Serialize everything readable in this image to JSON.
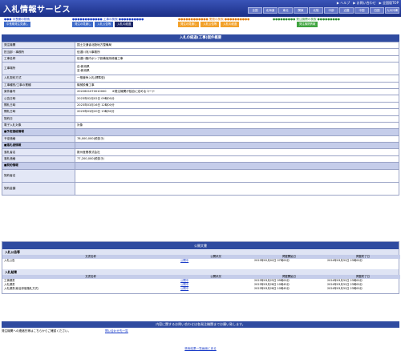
{
  "header": {
    "title": "入札情報サービス",
    "links": [
      "▶ ヘルプ",
      "▶ お問い合わせ",
      "▶ 全国版TOP"
    ],
    "regions": [
      "全国",
      "北海道",
      "東北",
      "関東",
      "北陸",
      "中部",
      "近畿",
      "中国",
      "四国",
      "九州沖縄"
    ]
  },
  "nav": {
    "groups": [
      {
        "label": "中長期の検索",
        "label_color": "#1a3cc8",
        "tab_color": "#3f6bc9",
        "tabs": [
          "中長期発注見通し"
        ]
      },
      {
        "label": "工事の検索",
        "label_color": "#1a3cc8",
        "tab_color": "#1f2a6b",
        "tabs": [
          "発注の見通し",
          "入札公告等",
          "入札の経過"
        ]
      },
      {
        "label": "業務の検索",
        "label_color": "#e07a00",
        "tab_color": "#f2a12a",
        "tabs": [
          "発注の見通し",
          "入札公告等",
          "入札の経過"
        ]
      },
      {
        "label": "発注機関の検索",
        "label_color": "#2e8b2e",
        "tab_color": "#3fa43f",
        "tabs": [
          "発注機関情報"
        ]
      }
    ]
  },
  "detail": {
    "title": "入札の経過(工事)案件概要",
    "rows": [
      {
        "k": "発注機関",
        "v": "国土交通省北陸地方整備局",
        "type": "row"
      },
      {
        "k": "担当部・事務所",
        "v": "信濃川河川事務所",
        "type": "row"
      },
      {
        "k": "工事名称",
        "v": "信濃川管内ポンプ設備保持修繕工事",
        "type": "row"
      },
      {
        "k": "工事場所",
        "v": "自:新潟県\n至:新潟県",
        "type": "tall"
      },
      {
        "k": "入札契約方式",
        "v": "一般競争入札(標準型)",
        "type": "row"
      },
      {
        "k": "工事種別/工事の業種",
        "v": "機械設備工事",
        "type": "row"
      },
      {
        "k": "案件番号",
        "v": "2022601070010000　　※発注機関が独自に定めるコード",
        "type": "row"
      },
      {
        "k": "公告日時",
        "v": "2023年02月02日 09時00分",
        "type": "row"
      },
      {
        "k": "開札日時",
        "v": "2023年03月16日 12時00分",
        "type": "row"
      },
      {
        "k": "開札日時",
        "v": "2023年03月20日 13時30分",
        "type": "row"
      },
      {
        "k": "契約日",
        "v": "",
        "type": "row"
      },
      {
        "k": "電子入札対象",
        "v": "対象",
        "type": "row"
      },
      {
        "k": "■予定価格情報",
        "v": "",
        "type": "subh"
      },
      {
        "k": "予定価格",
        "v": "78,000,000(税抜き)",
        "type": "row"
      },
      {
        "k": "■落札者情報",
        "v": "",
        "type": "subh"
      },
      {
        "k": "落札者名",
        "v": "数州産業株式会社",
        "type": "row"
      },
      {
        "k": "落札価格",
        "v": "77,200,000(税抜き)",
        "type": "row"
      },
      {
        "k": "■契約情報",
        "v": "",
        "type": "subh"
      },
      {
        "k": "契約者名",
        "v": "",
        "type": "tall"
      },
      {
        "k": "契約金額",
        "v": "",
        "type": "tall"
      }
    ]
  },
  "documents": {
    "title": "公開文書",
    "headers": [
      "文書名称",
      "公開状況",
      "掲載開始日",
      "掲載終了日"
    ],
    "sections": [
      {
        "name": "入札公告等",
        "rows": [
          {
            "doc": "入札公告",
            "status": "公開中",
            "start": "2023年02月02日 07時00分",
            "end": "2024年03月31日 23時00分"
          }
        ]
      },
      {
        "name": "入札結果",
        "rows": [
          {
            "doc": "工事調書",
            "status": "公開中",
            "start": "2023年03月25日 09時00分",
            "end": "2024年03月31日 23時00分"
          },
          {
            "doc": "入札調書",
            "status": "公開中",
            "start": "2023年03月28日 10時45分",
            "end": "2024年03月31日 23時00分"
          },
          {
            "doc": "入札調書(総合評価落札方式)",
            "status": "公開中",
            "start": "2023年03月28日 10時45分",
            "end": "2024年03月31日 23時00分"
          }
        ]
      }
    ]
  },
  "contact": {
    "title": "内容に関するお問い合わせは各発注機関までお願い致します。",
    "text": "発注機関への連絡先等はこちらからご確認ください。",
    "link": "問い合わせ先一覧"
  },
  "back_link": "検索結果一覧画面に戻る",
  "colors": {
    "accent": "#2f4ba0",
    "key_bg": "#e3e7f6"
  }
}
